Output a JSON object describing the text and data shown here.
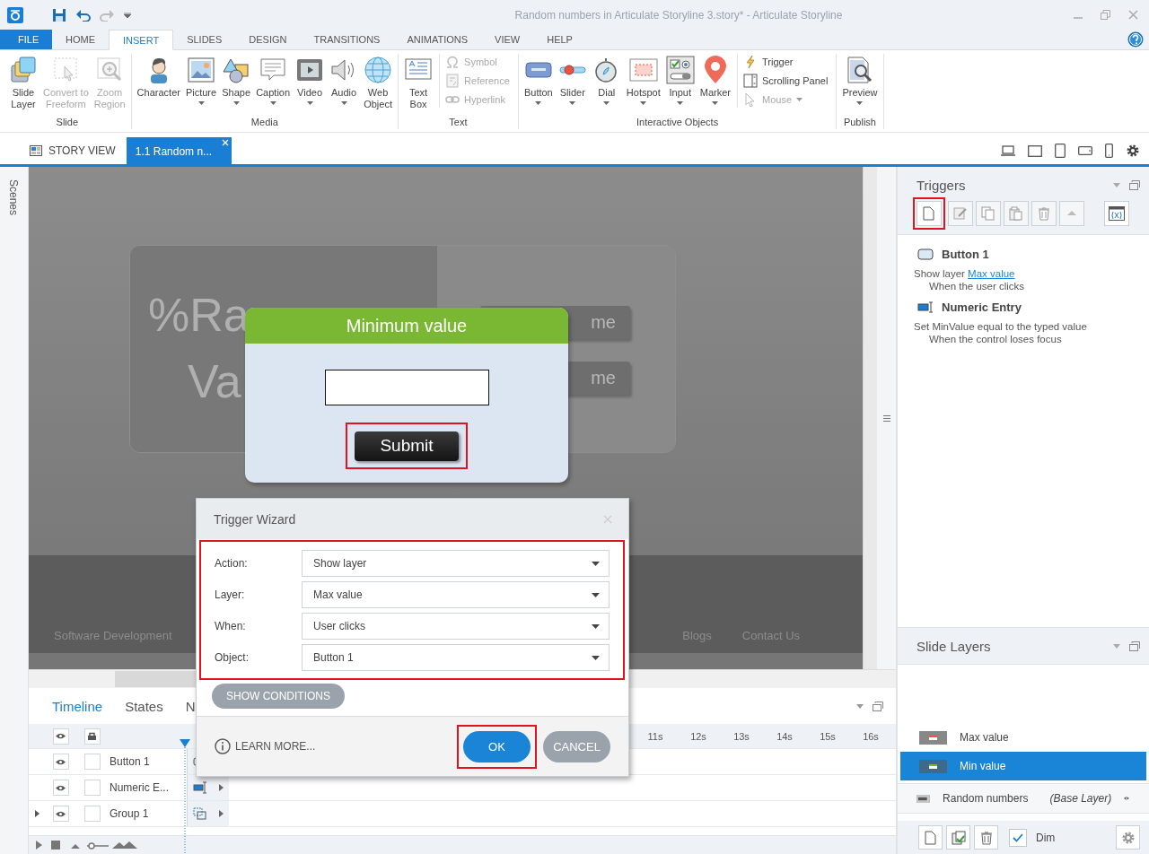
{
  "window": {
    "title": "Random numbers in Articulate Storyline 3.story* -  Articulate Storyline"
  },
  "menu_tabs": [
    {
      "label": "FILE",
      "kind": "file",
      "selected": false
    },
    {
      "label": "HOME",
      "kind": "tab",
      "selected": false
    },
    {
      "label": "INSERT",
      "kind": "tab",
      "selected": true
    },
    {
      "label": "SLIDES",
      "kind": "tab",
      "selected": false
    },
    {
      "label": "DESIGN",
      "kind": "tab",
      "selected": false
    },
    {
      "label": "TRANSITIONS",
      "kind": "tab",
      "selected": false
    },
    {
      "label": "ANIMATIONS",
      "kind": "tab",
      "selected": false
    },
    {
      "label": "VIEW",
      "kind": "tab",
      "selected": false
    },
    {
      "label": "HELP",
      "kind": "tab",
      "selected": false
    }
  ],
  "ribbon": {
    "groups": [
      {
        "label": "Slide",
        "items": [
          {
            "label": "Slide\nLayer",
            "kind": "large",
            "dropdown": false,
            "disabled": false
          },
          {
            "label": "Convert to\nFreeform",
            "kind": "large",
            "dropdown": false,
            "disabled": true
          },
          {
            "label": "Zoom\nRegion",
            "kind": "large",
            "dropdown": false,
            "disabled": true
          }
        ]
      },
      {
        "label": "Media",
        "items": [
          {
            "label": "Character",
            "kind": "large",
            "dropdown": false,
            "disabled": false
          },
          {
            "label": "Picture",
            "kind": "large",
            "dropdown": true,
            "disabled": false
          },
          {
            "label": "Shape",
            "kind": "large",
            "dropdown": true,
            "disabled": false
          },
          {
            "label": "Caption",
            "kind": "large",
            "dropdown": true,
            "disabled": false
          },
          {
            "label": "Video",
            "kind": "large",
            "dropdown": true,
            "disabled": false
          },
          {
            "label": "Audio",
            "kind": "large",
            "dropdown": true,
            "disabled": false
          },
          {
            "label": "Web\nObject",
            "kind": "large",
            "dropdown": false,
            "disabled": false
          }
        ]
      },
      {
        "label": "Text",
        "items": [
          {
            "label": "Text\nBox",
            "kind": "large",
            "dropdown": false,
            "disabled": false
          },
          {
            "label": "Symbol",
            "kind": "small",
            "dropdown": false,
            "disabled": true
          },
          {
            "label": "Reference",
            "kind": "small",
            "dropdown": false,
            "disabled": true
          },
          {
            "label": "Hyperlink",
            "kind": "small",
            "dropdown": false,
            "disabled": true
          }
        ]
      },
      {
        "label": "Interactive Objects",
        "items": [
          {
            "label": "Button",
            "kind": "large",
            "dropdown": true,
            "disabled": false
          },
          {
            "label": "Slider",
            "kind": "large",
            "dropdown": true,
            "disabled": false
          },
          {
            "label": "Dial",
            "kind": "large",
            "dropdown": true,
            "disabled": false
          },
          {
            "label": "Hotspot",
            "kind": "large",
            "dropdown": true,
            "disabled": false
          },
          {
            "label": "Input",
            "kind": "large",
            "dropdown": true,
            "disabled": false
          },
          {
            "label": "Marker",
            "kind": "large",
            "dropdown": true,
            "disabled": false
          },
          {
            "label": "Trigger",
            "kind": "small",
            "dropdown": false,
            "disabled": false
          },
          {
            "label": "Scrolling Panel",
            "kind": "small",
            "dropdown": false,
            "disabled": false
          },
          {
            "label": "Mouse",
            "kind": "small",
            "dropdown": true,
            "disabled": true
          }
        ]
      },
      {
        "label": "Publish",
        "items": [
          {
            "label": "Preview",
            "kind": "large",
            "dropdown": true,
            "disabled": false
          }
        ]
      }
    ]
  },
  "doc_tabs": [
    {
      "label": "STORY VIEW",
      "selected": false
    },
    {
      "label": "1.1 Random n...",
      "selected": true
    }
  ],
  "scenes_label": "Scenes",
  "slide": {
    "title_parts": [
      "%Ra",
      "Va"
    ],
    "buttons": [
      "me",
      "me"
    ],
    "footer_left": "Software Development",
    "footer_links": [
      "Blogs",
      "Contact Us"
    ]
  },
  "layer_popup": {
    "title": "Minimum value",
    "button": "Submit"
  },
  "trigger_wizard": {
    "title": "Trigger Wizard",
    "fields": [
      {
        "label": "Action:",
        "value": "Show layer"
      },
      {
        "label": "Layer:",
        "value": "Max value"
      },
      {
        "label": "When:",
        "value": "User clicks"
      },
      {
        "label": "Object:",
        "value": "Button 1"
      }
    ],
    "conditions_button": "SHOW CONDITIONS",
    "learn_more": "LEARN MORE...",
    "ok": "OK",
    "cancel": "CANCEL"
  },
  "timeline": {
    "tabs": [
      {
        "label": "Timeline",
        "selected": true
      },
      {
        "label": "States",
        "selected": false
      },
      {
        "label": "N",
        "selected": false
      }
    ],
    "ruler": [
      "11s",
      "12s",
      "13s",
      "14s",
      "15s",
      "16s"
    ],
    "rows": [
      {
        "name": "Button 1",
        "expandable": false,
        "locked": false
      },
      {
        "name": "Numeric E...",
        "expandable": false,
        "locked": false
      },
      {
        "name": "Group 1",
        "expandable": true,
        "locked": false
      }
    ]
  },
  "triggers": {
    "title": "Triggers",
    "items": [
      {
        "object": "Button 1",
        "action": "Show layer",
        "link": "Max value",
        "condition": "When the user clicks"
      },
      {
        "object": "Numeric Entry",
        "action": "Set MinValue equal to the typed value",
        "condition": "When the control loses focus"
      }
    ]
  },
  "slide_layers": {
    "title": "Slide Layers",
    "items": [
      {
        "name": "Max value",
        "selected": false
      },
      {
        "name": "Min value",
        "selected": true
      },
      {
        "name": "Random numbers",
        "note": "(Base Layer)",
        "selected": false
      }
    ],
    "dim": {
      "label": "Dim",
      "checked": true
    }
  }
}
